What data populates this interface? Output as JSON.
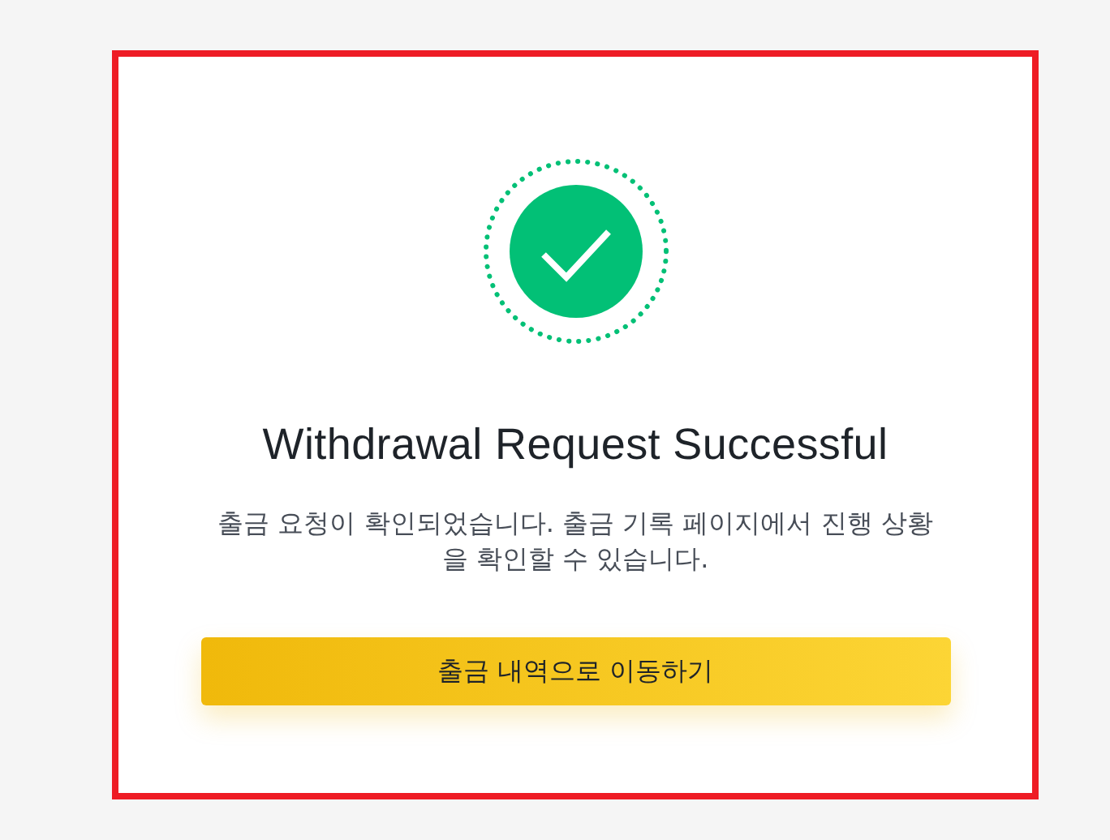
{
  "dialog": {
    "title": "Withdrawal Request Successful",
    "message": "출금 요청이 확인되었습니다. 출금 기록 페이지에서 진행 상황을 확인할 수 있습니다.",
    "button": "출금 내역으로 이동하기"
  }
}
